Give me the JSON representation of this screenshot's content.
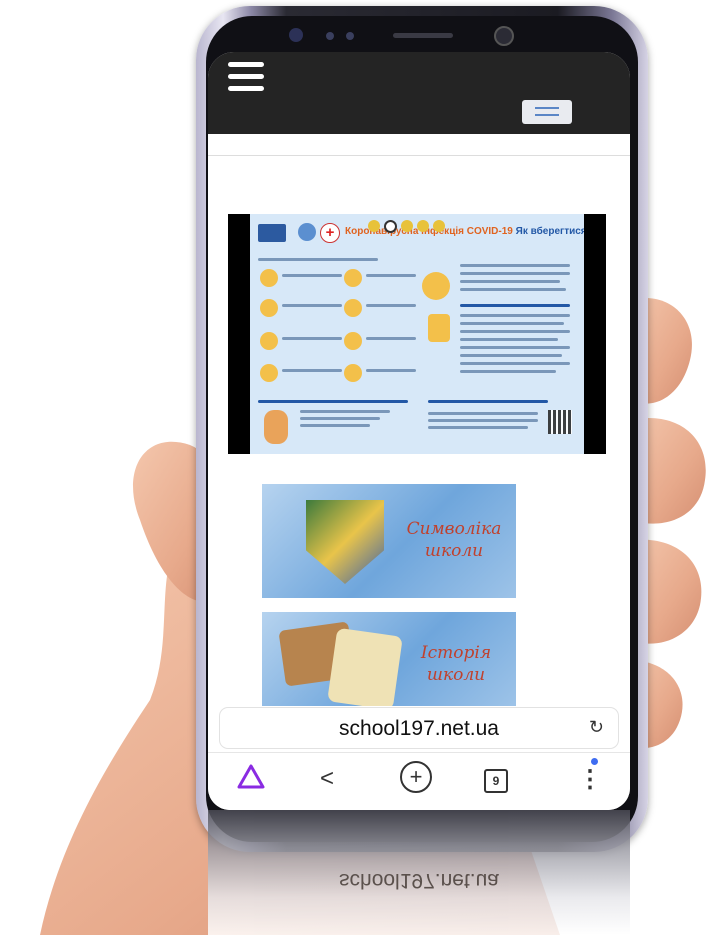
{
  "browser": {
    "url": "school197.net.ua",
    "tabs_count": "9",
    "reload_icon": "reload-icon",
    "nav_icons": [
      "alice-icon",
      "share-icon",
      "add-icon",
      "tabs-icon",
      "more-icon"
    ]
  },
  "site": {
    "menu_icon": "hamburger-icon"
  },
  "slider": {
    "poster_title_accent": "Коронавірусна інфекція COVID-19",
    "poster_title_rest": " Як вберегтися",
    "prev_icon": "chevron-left-icon",
    "dots_count": 5,
    "active_dot": 1
  },
  "banners": [
    {
      "line1": "Символіка",
      "line2": "школи"
    },
    {
      "line1": "Історія",
      "line2": "школи"
    }
  ],
  "colors": {
    "topbar": "#242424",
    "poster_bg": "#d7e8f8",
    "banner_text": "#c0412d",
    "alice_purple": "#8a2be2",
    "notify_dot": "#3f6df1"
  }
}
